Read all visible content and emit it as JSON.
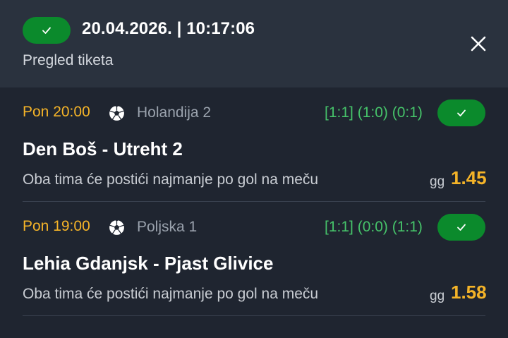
{
  "header": {
    "datetime": "20.04.2026. | 10:17:06",
    "subtitle": "Pregled tiketa",
    "status_icon": "check-icon",
    "close_icon": "close-icon",
    "status_color": "#0b8a2c"
  },
  "matches": [
    {
      "time": "Pon 20:00",
      "sport_icon": "soccer-ball-icon",
      "league": "Holandija 2",
      "score": "[1:1] (1:0) (0:1)",
      "teams": "Den Boš - Utreht 2",
      "bet": "Oba tima će postići najmanje po gol na meču",
      "bet_code": "gg",
      "odd": "1.45"
    },
    {
      "time": "Pon 19:00",
      "sport_icon": "soccer-ball-icon",
      "league": "Poljska 1",
      "score": "[1:1] (0:0) (1:1)",
      "teams": "Lehia Gdanjsk - Pjast Glivice",
      "bet": "Oba tima će postići najmanje po gol na meču",
      "bet_code": "gg",
      "odd": "1.58"
    }
  ],
  "colors": {
    "accent_time": "#f5b428",
    "score_green": "#46c46a",
    "background": "#1f2530",
    "header_bg": "#2a323e"
  }
}
